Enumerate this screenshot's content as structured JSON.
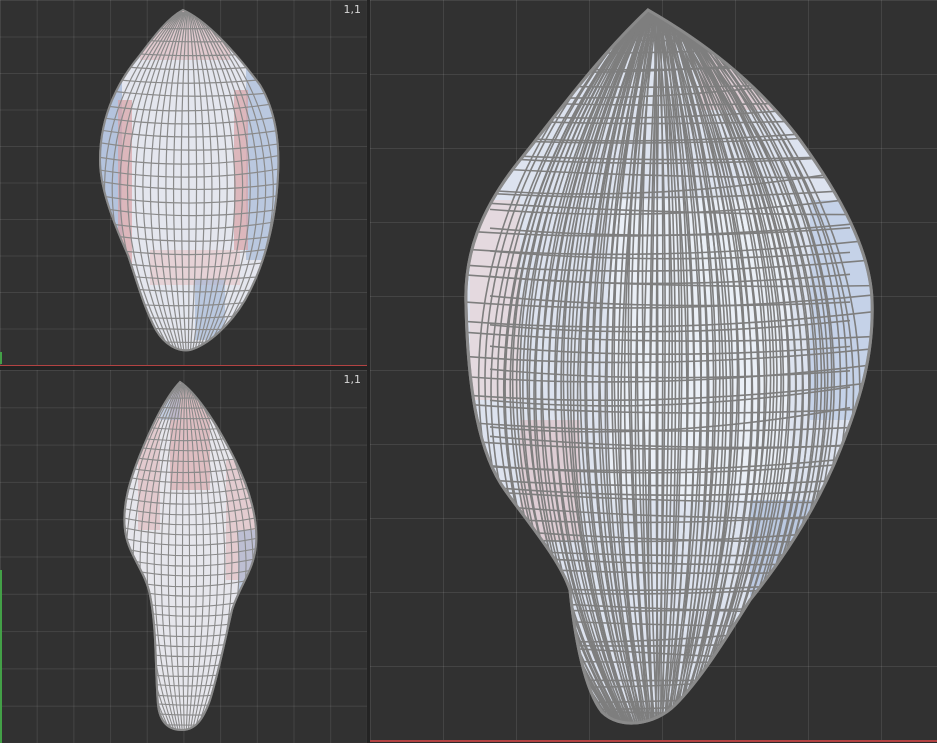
{
  "viewports": {
    "top": {
      "label": "1,1"
    },
    "bottom": {
      "label": "1,1"
    }
  },
  "colors": {
    "mesh_fill": "#e6e8ef",
    "wire": "#8a8a8a",
    "blue_tint": "#9fb4d6",
    "red_tint": "#d9a3a6",
    "background": "#313131",
    "frame_border": "#b34343"
  }
}
